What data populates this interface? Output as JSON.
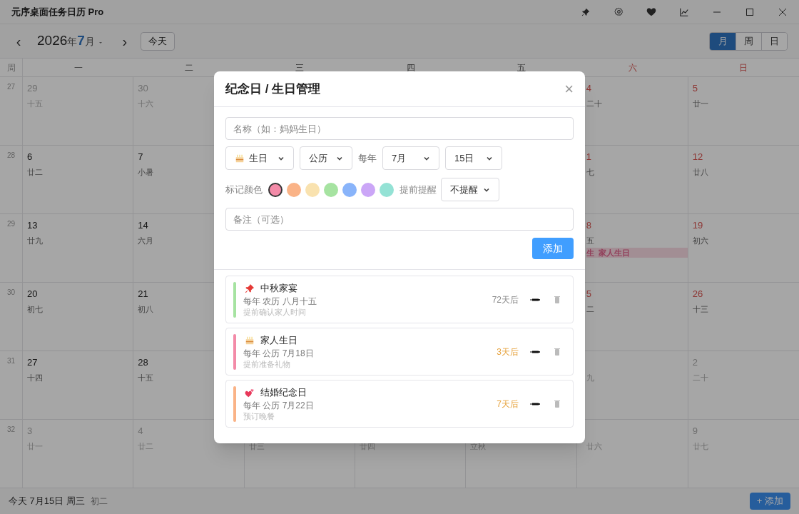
{
  "window": {
    "title": "元序桌面任务日历 Pro"
  },
  "toolbar": {
    "prev": "‹",
    "year": "2026",
    "year_unit": "年",
    "month": "7",
    "month_unit": "月",
    "next": "›",
    "today_button": "今天",
    "views": [
      {
        "label": "月",
        "selected": true
      },
      {
        "label": "周",
        "selected": false
      },
      {
        "label": "日",
        "selected": false
      }
    ]
  },
  "calendar": {
    "headers": [
      {
        "label": "周"
      },
      {
        "label": "一",
        "weekend": false
      },
      {
        "label": "二",
        "weekend": false
      },
      {
        "label": "三",
        "weekend": false
      },
      {
        "label": "四",
        "weekend": false
      },
      {
        "label": "五",
        "weekend": false
      },
      {
        "label": "六",
        "weekend": true
      },
      {
        "label": "日",
        "weekend": true
      }
    ],
    "rows": [
      {
        "week": "27",
        "cells": [
          {
            "date": "29",
            "lunar": "十五",
            "muted": true
          },
          {
            "date": "30",
            "lunar": "十六",
            "muted": true
          },
          {},
          {},
          {},
          {
            "date": "4",
            "lunar": "二十",
            "muted": false,
            "weekend": true
          },
          {
            "date": "5",
            "lunar": "廿一",
            "muted": false,
            "weekend": true
          }
        ]
      },
      {
        "week": "28",
        "cells": [
          {
            "date": "6",
            "lunar": "廿二",
            "muted": false,
            "weekend": false
          },
          {
            "date": "7",
            "lunar": "小暑",
            "muted": false,
            "weekend": false
          },
          {},
          {},
          {},
          {
            "date": "1",
            "lunar": "七",
            "muted": false,
            "weekend": true
          },
          {
            "date": "12",
            "lunar": "廿八",
            "muted": false,
            "weekend": true
          }
        ]
      },
      {
        "week": "29",
        "cells": [
          {
            "date": "13",
            "lunar": "廿九",
            "muted": false,
            "weekend": false
          },
          {
            "date": "14",
            "lunar": "六月",
            "muted": false,
            "weekend": false
          },
          {},
          {},
          {},
          {
            "date": "8",
            "lunar": "五",
            "muted": false,
            "weekend": true,
            "events": [
              {
                "tag": "生",
                "title": "家人生日"
              }
            ]
          },
          {
            "date": "19",
            "lunar": "初六",
            "muted": false,
            "weekend": true
          }
        ]
      },
      {
        "week": "30",
        "cells": [
          {
            "date": "20",
            "lunar": "初七",
            "muted": false,
            "weekend": false
          },
          {
            "date": "21",
            "lunar": "初八",
            "muted": false,
            "weekend": false
          },
          {},
          {},
          {},
          {
            "date": "5",
            "lunar": "二",
            "muted": false,
            "weekend": true
          },
          {
            "date": "26",
            "lunar": "十三",
            "muted": false,
            "weekend": true
          }
        ]
      },
      {
        "week": "31",
        "cells": [
          {
            "date": "27",
            "lunar": "十四",
            "muted": false,
            "weekend": false
          },
          {
            "date": "28",
            "lunar": "十五",
            "muted": false,
            "weekend": false
          },
          {},
          {},
          {},
          {
            "lunar": "九",
            "muted": true
          },
          {
            "date": "2",
            "lunar": "二十",
            "muted": true
          }
        ]
      },
      {
        "week": "32",
        "cells": [
          {
            "date": "3",
            "lunar": "廿一",
            "muted": true
          },
          {
            "date": "4",
            "lunar": "廿二",
            "muted": true
          },
          {
            "lunar": "廿三",
            "muted": true
          },
          {
            "lunar": "廿四",
            "muted": true
          },
          {
            "lunar": "立秋",
            "muted": true
          },
          {
            "lunar": "廿六",
            "muted": true
          },
          {
            "date": "9",
            "lunar": "廿七",
            "muted": true
          }
        ]
      }
    ]
  },
  "status_bar": {
    "today": "今天 7月15日 周三",
    "lunar": "初二",
    "add_button": "+ 添加"
  },
  "dialog": {
    "title": "纪念日 / 生日管理",
    "close": "×",
    "name_field": {
      "placeholder": "名称（如：妈妈生日）"
    },
    "type_select": {
      "kind": "cake",
      "value": "生日"
    },
    "calendar_select": {
      "value": "公历"
    },
    "every_year": "每年",
    "month_select": {
      "value": "7月"
    },
    "day_select": {
      "value": "15日"
    },
    "color_label": "标记颜色",
    "colors": [
      {
        "color": "#f38ba8",
        "selected": true
      },
      {
        "color": "#fab387",
        "selected": false
      },
      {
        "color": "#f9e2af",
        "selected": false
      },
      {
        "color": "#a6e3a1",
        "selected": false
      },
      {
        "color": "#89b4fa",
        "selected": false
      },
      {
        "color": "#cba6f7",
        "selected": false
      },
      {
        "color": "#94e2d5",
        "selected": false
      }
    ],
    "remind_label": "提前提醒",
    "remind_select": {
      "value": "不提醒"
    },
    "note_field": {
      "placeholder": "备注（可选）"
    },
    "add_button": "添加",
    "items": [
      {
        "kind": "pin",
        "name": "中秋家宴",
        "detail": "每年 农历 八月十五",
        "note": "提前确认家人时间",
        "countdown": "72天后",
        "soon": false,
        "color": "#a6e3a1"
      },
      {
        "kind": "cake",
        "name": "家人生日",
        "detail": "每年 公历 7月18日",
        "note": "提前准备礼物",
        "countdown": "3天后",
        "soon": true,
        "color": "#f38ba8"
      },
      {
        "kind": "hearts",
        "name": "结婚纪念日",
        "detail": "每年 公历 7月22日",
        "note": "预订晚餐",
        "countdown": "7天后",
        "soon": true,
        "color": "#fab387"
      }
    ]
  }
}
